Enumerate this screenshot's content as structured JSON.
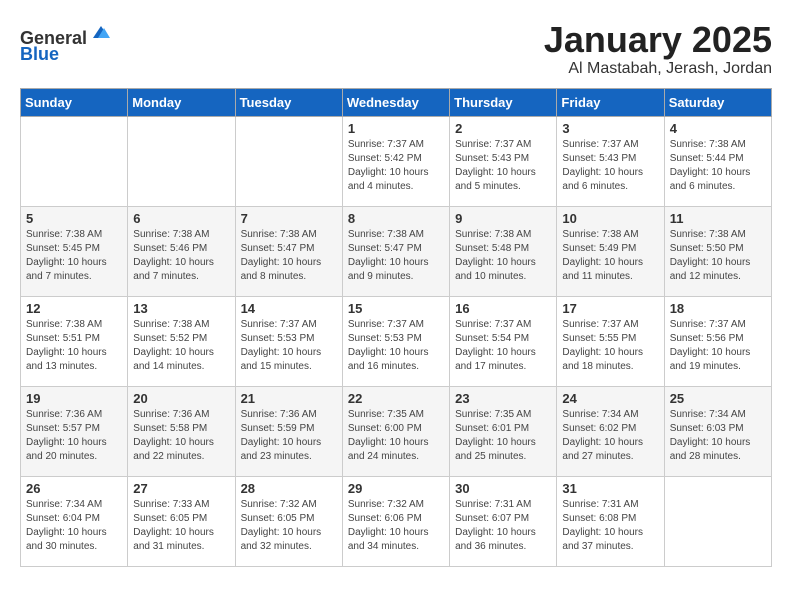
{
  "header": {
    "logo_line1": "General",
    "logo_line2": "Blue",
    "title": "January 2025",
    "subtitle": "Al Mastabah, Jerash, Jordan"
  },
  "weekdays": [
    "Sunday",
    "Monday",
    "Tuesday",
    "Wednesday",
    "Thursday",
    "Friday",
    "Saturday"
  ],
  "weeks": [
    [
      {
        "day": "",
        "sunrise": "",
        "sunset": "",
        "daylight": ""
      },
      {
        "day": "",
        "sunrise": "",
        "sunset": "",
        "daylight": ""
      },
      {
        "day": "",
        "sunrise": "",
        "sunset": "",
        "daylight": ""
      },
      {
        "day": "1",
        "sunrise": "Sunrise: 7:37 AM",
        "sunset": "Sunset: 5:42 PM",
        "daylight": "Daylight: 10 hours and 4 minutes."
      },
      {
        "day": "2",
        "sunrise": "Sunrise: 7:37 AM",
        "sunset": "Sunset: 5:43 PM",
        "daylight": "Daylight: 10 hours and 5 minutes."
      },
      {
        "day": "3",
        "sunrise": "Sunrise: 7:37 AM",
        "sunset": "Sunset: 5:43 PM",
        "daylight": "Daylight: 10 hours and 6 minutes."
      },
      {
        "day": "4",
        "sunrise": "Sunrise: 7:38 AM",
        "sunset": "Sunset: 5:44 PM",
        "daylight": "Daylight: 10 hours and 6 minutes."
      }
    ],
    [
      {
        "day": "5",
        "sunrise": "Sunrise: 7:38 AM",
        "sunset": "Sunset: 5:45 PM",
        "daylight": "Daylight: 10 hours and 7 minutes."
      },
      {
        "day": "6",
        "sunrise": "Sunrise: 7:38 AM",
        "sunset": "Sunset: 5:46 PM",
        "daylight": "Daylight: 10 hours and 7 minutes."
      },
      {
        "day": "7",
        "sunrise": "Sunrise: 7:38 AM",
        "sunset": "Sunset: 5:47 PM",
        "daylight": "Daylight: 10 hours and 8 minutes."
      },
      {
        "day": "8",
        "sunrise": "Sunrise: 7:38 AM",
        "sunset": "Sunset: 5:47 PM",
        "daylight": "Daylight: 10 hours and 9 minutes."
      },
      {
        "day": "9",
        "sunrise": "Sunrise: 7:38 AM",
        "sunset": "Sunset: 5:48 PM",
        "daylight": "Daylight: 10 hours and 10 minutes."
      },
      {
        "day": "10",
        "sunrise": "Sunrise: 7:38 AM",
        "sunset": "Sunset: 5:49 PM",
        "daylight": "Daylight: 10 hours and 11 minutes."
      },
      {
        "day": "11",
        "sunrise": "Sunrise: 7:38 AM",
        "sunset": "Sunset: 5:50 PM",
        "daylight": "Daylight: 10 hours and 12 minutes."
      }
    ],
    [
      {
        "day": "12",
        "sunrise": "Sunrise: 7:38 AM",
        "sunset": "Sunset: 5:51 PM",
        "daylight": "Daylight: 10 hours and 13 minutes."
      },
      {
        "day": "13",
        "sunrise": "Sunrise: 7:38 AM",
        "sunset": "Sunset: 5:52 PM",
        "daylight": "Daylight: 10 hours and 14 minutes."
      },
      {
        "day": "14",
        "sunrise": "Sunrise: 7:37 AM",
        "sunset": "Sunset: 5:53 PM",
        "daylight": "Daylight: 10 hours and 15 minutes."
      },
      {
        "day": "15",
        "sunrise": "Sunrise: 7:37 AM",
        "sunset": "Sunset: 5:53 PM",
        "daylight": "Daylight: 10 hours and 16 minutes."
      },
      {
        "day": "16",
        "sunrise": "Sunrise: 7:37 AM",
        "sunset": "Sunset: 5:54 PM",
        "daylight": "Daylight: 10 hours and 17 minutes."
      },
      {
        "day": "17",
        "sunrise": "Sunrise: 7:37 AM",
        "sunset": "Sunset: 5:55 PM",
        "daylight": "Daylight: 10 hours and 18 minutes."
      },
      {
        "day": "18",
        "sunrise": "Sunrise: 7:37 AM",
        "sunset": "Sunset: 5:56 PM",
        "daylight": "Daylight: 10 hours and 19 minutes."
      }
    ],
    [
      {
        "day": "19",
        "sunrise": "Sunrise: 7:36 AM",
        "sunset": "Sunset: 5:57 PM",
        "daylight": "Daylight: 10 hours and 20 minutes."
      },
      {
        "day": "20",
        "sunrise": "Sunrise: 7:36 AM",
        "sunset": "Sunset: 5:58 PM",
        "daylight": "Daylight: 10 hours and 22 minutes."
      },
      {
        "day": "21",
        "sunrise": "Sunrise: 7:36 AM",
        "sunset": "Sunset: 5:59 PM",
        "daylight": "Daylight: 10 hours and 23 minutes."
      },
      {
        "day": "22",
        "sunrise": "Sunrise: 7:35 AM",
        "sunset": "Sunset: 6:00 PM",
        "daylight": "Daylight: 10 hours and 24 minutes."
      },
      {
        "day": "23",
        "sunrise": "Sunrise: 7:35 AM",
        "sunset": "Sunset: 6:01 PM",
        "daylight": "Daylight: 10 hours and 25 minutes."
      },
      {
        "day": "24",
        "sunrise": "Sunrise: 7:34 AM",
        "sunset": "Sunset: 6:02 PM",
        "daylight": "Daylight: 10 hours and 27 minutes."
      },
      {
        "day": "25",
        "sunrise": "Sunrise: 7:34 AM",
        "sunset": "Sunset: 6:03 PM",
        "daylight": "Daylight: 10 hours and 28 minutes."
      }
    ],
    [
      {
        "day": "26",
        "sunrise": "Sunrise: 7:34 AM",
        "sunset": "Sunset: 6:04 PM",
        "daylight": "Daylight: 10 hours and 30 minutes."
      },
      {
        "day": "27",
        "sunrise": "Sunrise: 7:33 AM",
        "sunset": "Sunset: 6:05 PM",
        "daylight": "Daylight: 10 hours and 31 minutes."
      },
      {
        "day": "28",
        "sunrise": "Sunrise: 7:32 AM",
        "sunset": "Sunset: 6:05 PM",
        "daylight": "Daylight: 10 hours and 32 minutes."
      },
      {
        "day": "29",
        "sunrise": "Sunrise: 7:32 AM",
        "sunset": "Sunset: 6:06 PM",
        "daylight": "Daylight: 10 hours and 34 minutes."
      },
      {
        "day": "30",
        "sunrise": "Sunrise: 7:31 AM",
        "sunset": "Sunset: 6:07 PM",
        "daylight": "Daylight: 10 hours and 36 minutes."
      },
      {
        "day": "31",
        "sunrise": "Sunrise: 7:31 AM",
        "sunset": "Sunset: 6:08 PM",
        "daylight": "Daylight: 10 hours and 37 minutes."
      },
      {
        "day": "",
        "sunrise": "",
        "sunset": "",
        "daylight": ""
      }
    ]
  ]
}
